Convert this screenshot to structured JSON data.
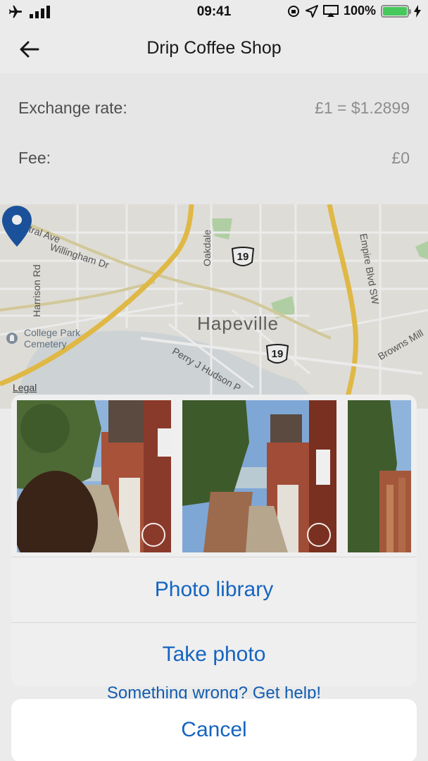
{
  "status_bar": {
    "time": "09:41",
    "battery": "100%",
    "battery_level": 1.0
  },
  "nav": {
    "title": "Drip Coffee Shop"
  },
  "info": {
    "exchange_label": "Exchange rate:",
    "exchange_value": "£1 = $1.2899",
    "fee_label": "Fee:",
    "fee_value": "£0"
  },
  "map": {
    "town": "Hapeville",
    "labels": {
      "central_ave": "Central Ave",
      "willingham": "Willingham Dr",
      "harrison": "Harrison Rd",
      "oakdale": "Oakdale",
      "empire": "Empire Blvd SW",
      "college_park": "College Park",
      "cemetery": "Cemetery",
      "perry": "Perry J Hudson P",
      "browns_mill": "Browns Mill"
    },
    "route_shield": "19",
    "legal": "Legal",
    "colors": {
      "pin": "#1e58a8",
      "highway": "#f2c84b",
      "park": "#bfe0b1",
      "water": "#c9d8df"
    }
  },
  "help_link": "Something wrong? Get help!",
  "action_sheet": {
    "photo_library": "Photo library",
    "take_photo": "Take photo",
    "cancel": "Cancel"
  },
  "colors": {
    "accent": "#1565c0"
  }
}
